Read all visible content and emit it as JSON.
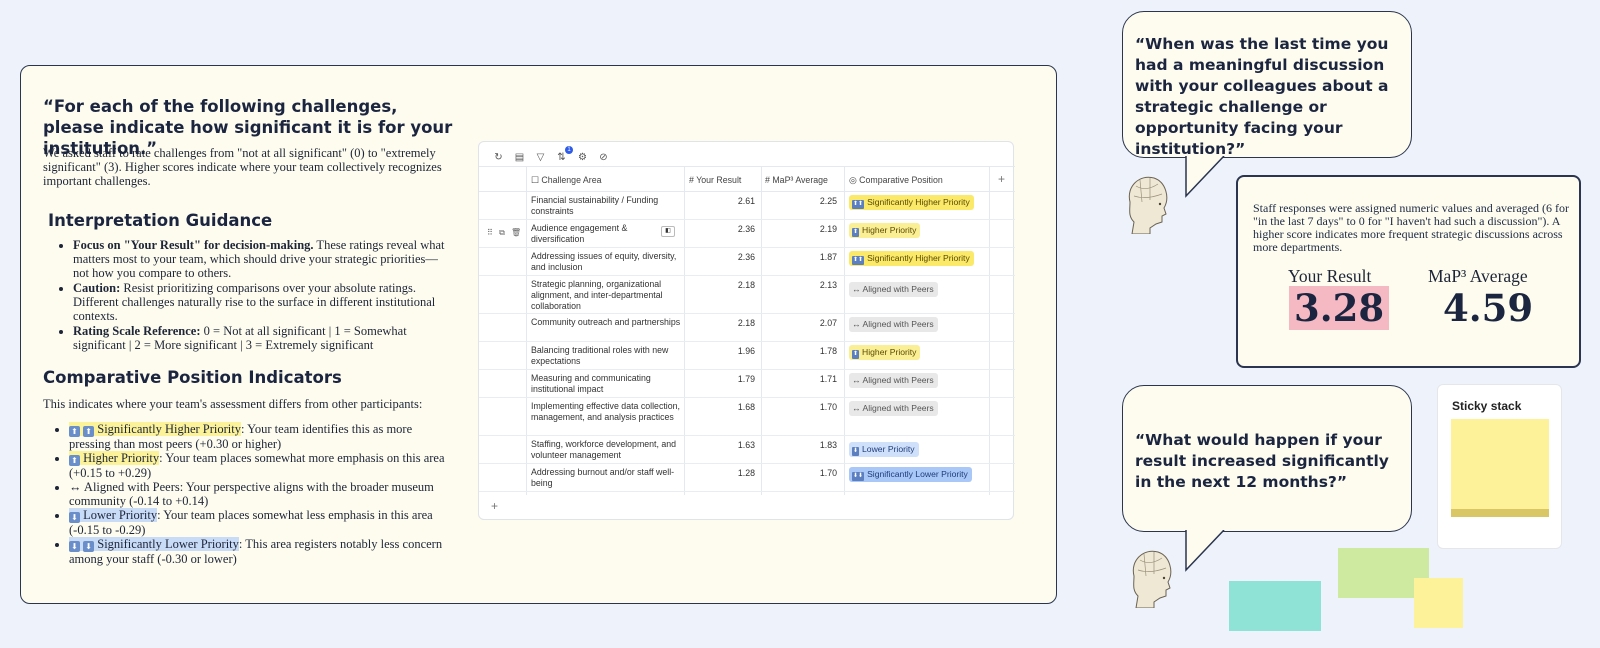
{
  "main": {
    "question": "“For each of the following challenges, please indicate how significant it is for your institution.”",
    "intro": "We asked staff to rate challenges from \"not at all significant\" (0) to \"extremely significant\" (3). Higher scores indicate where your team collectively recognizes important challenges.",
    "guidance_heading": "Interpretation Guidance",
    "guidance": [
      {
        "bold": "Focus on \"Your Result\" for decision-making.",
        "text": " These ratings reveal what matters most to your team, which should drive your strategic priorities—not how you compare to others."
      },
      {
        "bold": "Caution:",
        "text": " Resist prioritizing comparisons over your absolute ratings. Different challenges naturally rise to the surface in different institutional contexts."
      },
      {
        "bold": "Rating Scale Reference:",
        "text": " 0 = Not at all significant | 1 = Somewhat significant | 2 = More significant | 3 = Extremely significant"
      }
    ],
    "indicators_heading": "Comparative Position Indicators",
    "indicators_intro": "This indicates where your team's assessment differs from other participants:",
    "indicators": [
      {
        "label": "Significantly Higher Priority",
        "text": ": Your team identifies this as more pressing than most peers (+0.30 or higher)"
      },
      {
        "label": "Higher Priority",
        "text": ": Your team places somewhat more emphasis on this area (+0.15 to +0.29)"
      },
      {
        "label": "↔ Aligned with Peers",
        "text": ": Your perspective aligns with the broader museum community (-0.14 to +0.14)"
      },
      {
        "label": "Lower Priority",
        "text": ": Your team places somewhat less emphasis in this area (-0.15 to -0.29)"
      },
      {
        "label": "Significantly Lower Priority",
        "text": ": This area registers notably less concern among your staff (-0.30 or lower)"
      }
    ]
  },
  "table": {
    "filter_badge": "1",
    "headers": [
      "Challenge Area",
      "Your Result",
      "MaP³ Average",
      "Comparative Position"
    ],
    "rows": [
      {
        "area": "Financial sustainability / Funding constraints",
        "result": "2.61",
        "avg": "2.25",
        "position": "Significantly Higher Priority",
        "kind": "sh"
      },
      {
        "area": "Audience engagement & diversification",
        "result": "2.36",
        "avg": "2.19",
        "position": "Higher Priority",
        "kind": "h"
      },
      {
        "area": "Addressing issues of equity, diversity, and inclusion",
        "result": "2.36",
        "avg": "1.87",
        "position": "Significantly Higher Priority",
        "kind": "sh"
      },
      {
        "area": "Strategic planning, organizational alignment, and inter-departmental collaboration",
        "result": "2.18",
        "avg": "2.13",
        "position": "↔ Aligned with Peers",
        "kind": "a"
      },
      {
        "area": "Community outreach and partnerships",
        "result": "2.18",
        "avg": "2.07",
        "position": "↔ Aligned with Peers",
        "kind": "a"
      },
      {
        "area": "Balancing traditional roles with new expectations",
        "result": "1.96",
        "avg": "1.78",
        "position": "Higher Priority",
        "kind": "h"
      },
      {
        "area": "Measuring and communicating institutional impact",
        "result": "1.79",
        "avg": "1.71",
        "position": "↔ Aligned with Peers",
        "kind": "a"
      },
      {
        "area": "Implementing effective data collection, management, and analysis practices",
        "result": "1.68",
        "avg": "1.70",
        "position": "↔ Aligned with Peers",
        "kind": "a"
      },
      {
        "area": "Staffing, workforce development, and volunteer management",
        "result": "1.63",
        "avg": "1.83",
        "position": "Lower Priority",
        "kind": "l"
      },
      {
        "area": "Addressing burnout and/or staff well-being",
        "result": "1.28",
        "avg": "1.70",
        "position": "Significantly Lower Priority",
        "kind": "sl"
      }
    ]
  },
  "bubble1": "“When was the last time you had a meaningful discussion with your colleagues about a strategic challenge or opportunity facing your institution?”",
  "result_card": {
    "text": "Staff responses were assigned numeric values and averaged (6 for \"in the last 7 days\" to 0 for \"I haven't had such a discussion\"). A higher score indicates more frequent strategic discussions across more departments.",
    "your_label": "Your Result",
    "your_value": "3.28",
    "avg_label": "MaP³ Average",
    "avg_value": "4.59"
  },
  "bubble2": "“What would happen if your result increased significantly in the next 12 months?”",
  "sticky": {
    "title": "Sticky stack"
  },
  "colors": {
    "card_bg": "#fdfcee",
    "yellow": "#fbe96a",
    "blue": "#a9c7f7",
    "pink": "#f5b9c3",
    "teal": "#8fe3d6",
    "green": "#cdeaa0"
  }
}
